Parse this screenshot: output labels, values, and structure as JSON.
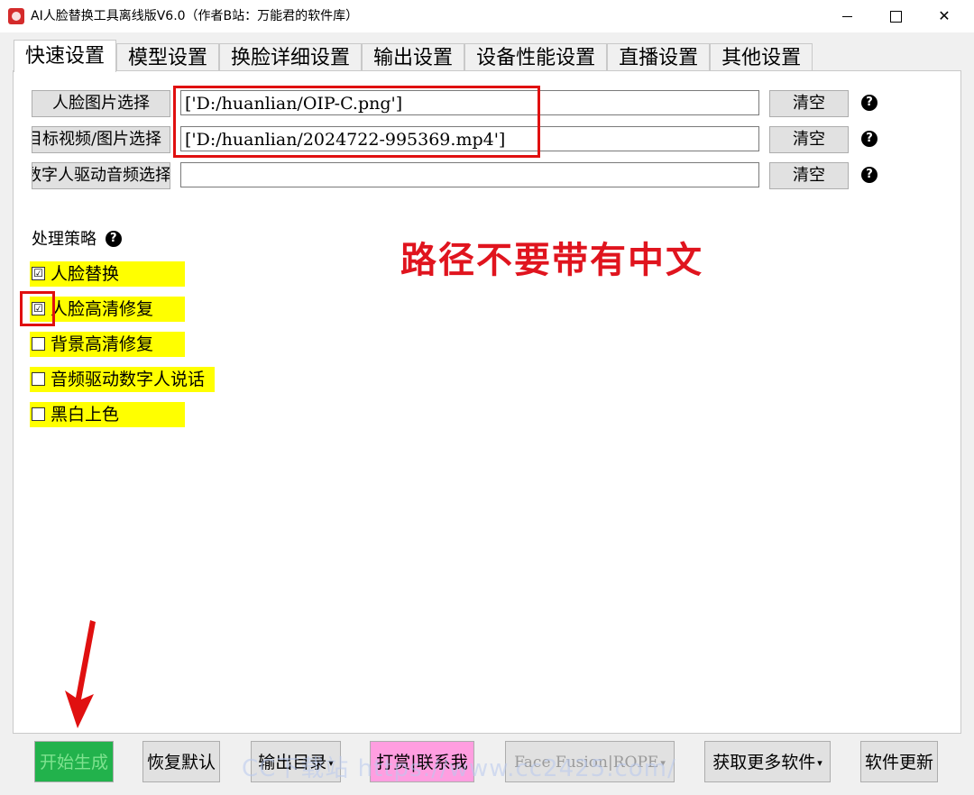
{
  "window": {
    "title": "AI人脸替换工具离线版V6.0（作者B站：万能君的软件库）",
    "minimize_glyph": "",
    "close_glyph": "✕"
  },
  "tabs": [
    {
      "label": "快速设置",
      "active": true
    },
    {
      "label": "模型设置"
    },
    {
      "label": "换脸详细设置"
    },
    {
      "label": "输出设置"
    },
    {
      "label": "设备性能设置"
    },
    {
      "label": "直播设置"
    },
    {
      "label": "其他设置"
    }
  ],
  "file_rows": [
    {
      "button": "人脸图片选择",
      "path": "['D:/huanlian/OIP-C.png']",
      "clear": "清空",
      "help": "?"
    },
    {
      "button": "目标视频/图片选择",
      "path": "['D:/huanlian/2024722-995369.mp4']",
      "clear": "清空",
      "help": "?"
    },
    {
      "button": "数字人驱动音频选择",
      "path": "",
      "clear": "清空",
      "help": "?"
    }
  ],
  "strategy": {
    "label": "处理策略",
    "help": "?",
    "options": [
      {
        "label": "人脸替换",
        "checked": true,
        "mark": "☑"
      },
      {
        "label": "人脸高清修复",
        "checked": true,
        "mark": "☑"
      },
      {
        "label": "背景高清修复",
        "checked": false,
        "mark": ""
      },
      {
        "label": "音频驱动数字人说话",
        "checked": false,
        "mark": ""
      },
      {
        "label": "黑白上色",
        "checked": false,
        "mark": ""
      }
    ]
  },
  "hint_text": "路径不要带有中文",
  "bottom": {
    "start": "开始生成",
    "restore": "恢复默认",
    "output_dir": "输出目录",
    "tip": "打赏|联系我",
    "face": "Face Fusion|ROPE",
    "more": "获取更多软件",
    "update": "软件更新",
    "caret": "▾"
  },
  "watermark": "CC下载站  https://www.cc2425.com/",
  "colors": {
    "highlight": "#ffff00",
    "annotation_red": "#e01010",
    "start_green": "#22b24c",
    "tip_pink": "#ff9ee0"
  }
}
